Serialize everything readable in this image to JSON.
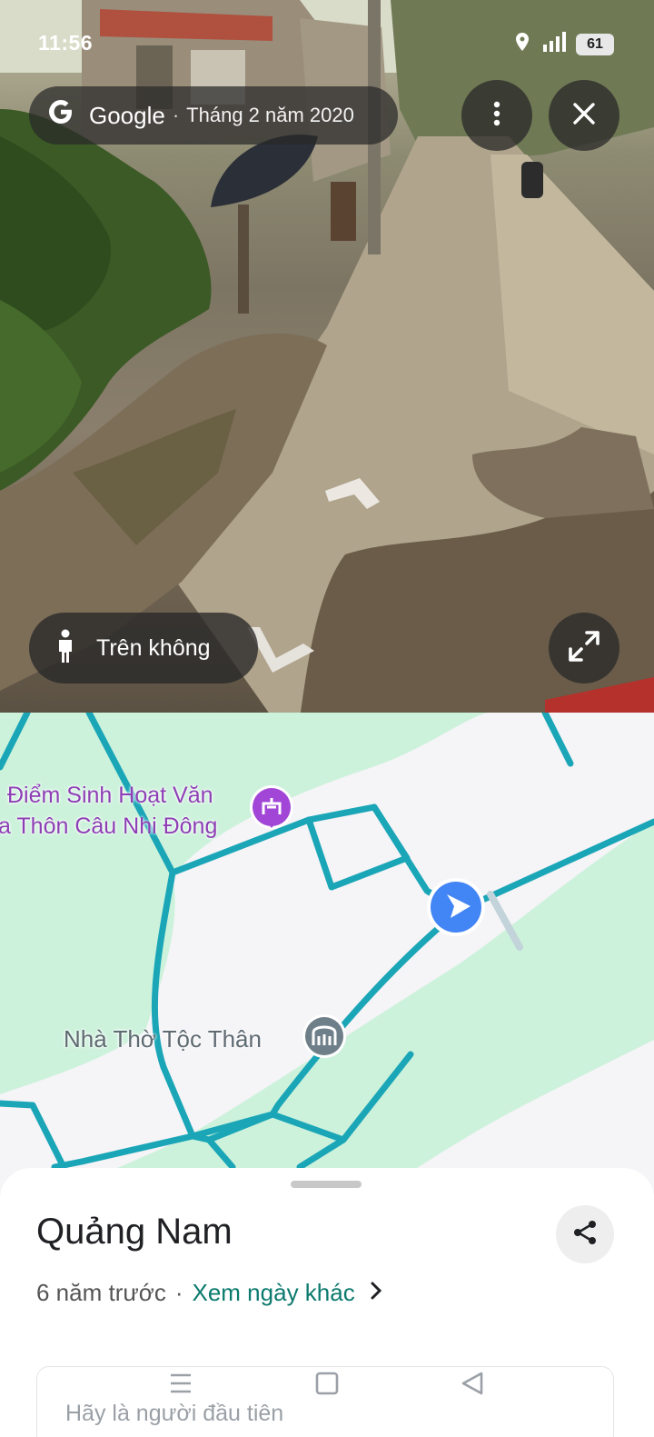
{
  "status_bar": {
    "time": "11:56",
    "battery": "61",
    "icons": [
      "location-icon",
      "signal-icon",
      "battery-icon"
    ]
  },
  "street_view": {
    "brand": "Google",
    "separator": "·",
    "capture_date": "Tháng 2 năm 2020",
    "mode_label": "Trên không",
    "icons": [
      "google-g-icon",
      "more-vert-icon",
      "close-icon",
      "pegman-icon",
      "fullscreen-icon",
      "navigation-arrow-icon"
    ]
  },
  "map": {
    "poi_1": {
      "line1": "Điểm Sinh Hoạt Văn",
      "line2": "a Thôn Câu Nhi Đông",
      "icon": "cultural-center-icon"
    },
    "poi_2": {
      "label": "Nhà Thờ Tộc Thân",
      "icon": "temple-icon"
    },
    "colors": {
      "land": "#cdf2dc",
      "road_area": "#f5f4f7",
      "coverage": "#1aa6b7",
      "arrow": "#4285f4"
    }
  },
  "sheet": {
    "title": "Quảng Nam",
    "time_ago": "6 năm trước",
    "separator": "·",
    "other_dates_link": "Xem ngày khác",
    "review_prompt": "Hãy là người đầu tiên",
    "icons": [
      "share-icon",
      "chevron-right-icon"
    ]
  },
  "nav_bar": {
    "icons": [
      "recents-icon",
      "home-icon",
      "back-icon"
    ]
  }
}
